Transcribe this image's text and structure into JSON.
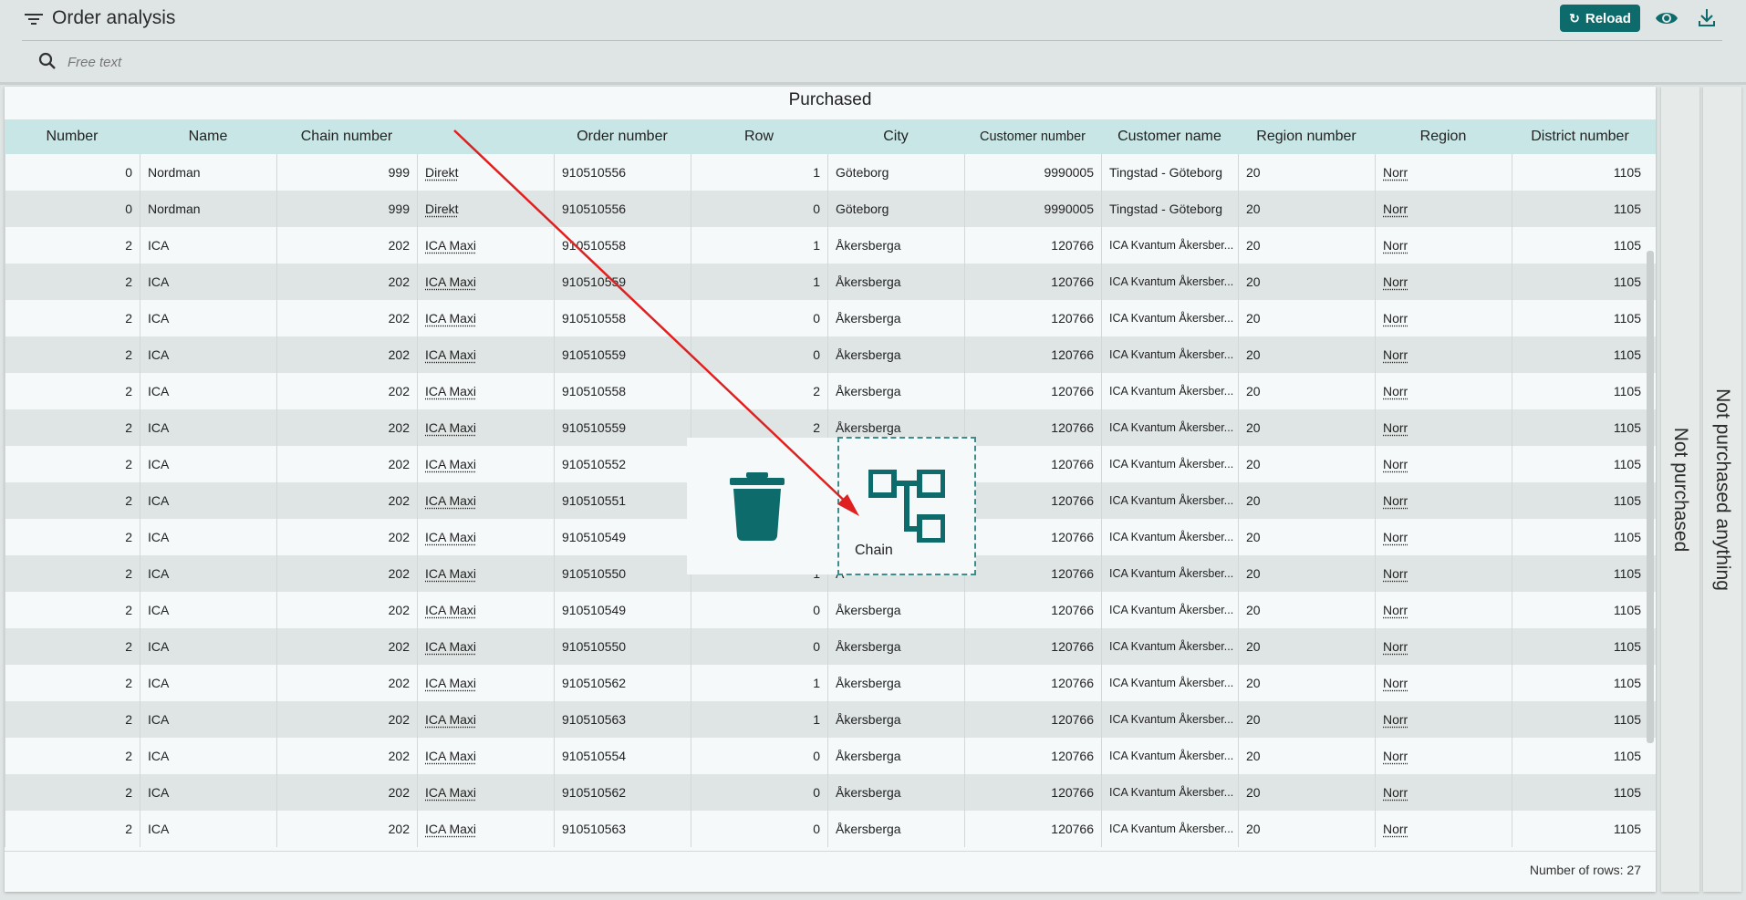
{
  "header": {
    "title": "Order analysis",
    "reload_label": "Reload",
    "search_placeholder": "Free text"
  },
  "panel": {
    "title": "Purchased",
    "row_count_label": "Number of rows: 27"
  },
  "columns": [
    "Number",
    "Name",
    "Chain number",
    "",
    "Order number",
    "Row",
    "City",
    "Customer number",
    "Customer name",
    "Region number",
    "Region",
    "District number"
  ],
  "rows": [
    [
      "0",
      "Nordman",
      "999",
      "Direkt",
      "910510556",
      "1",
      "Göteborg",
      "9990005",
      "Tingstad - Göteborg",
      "20",
      "Norr",
      "1105"
    ],
    [
      "0",
      "Nordman",
      "999",
      "Direkt",
      "910510556",
      "0",
      "Göteborg",
      "9990005",
      "Tingstad - Göteborg",
      "20",
      "Norr",
      "1105"
    ],
    [
      "2",
      "ICA",
      "202",
      "ICA Maxi",
      "910510558",
      "1",
      "Åkersberga",
      "120766",
      "ICA Kvantum Åkersber...",
      "20",
      "Norr",
      "1105"
    ],
    [
      "2",
      "ICA",
      "202",
      "ICA Maxi",
      "910510559",
      "1",
      "Åkersberga",
      "120766",
      "ICA Kvantum Åkersber...",
      "20",
      "Norr",
      "1105"
    ],
    [
      "2",
      "ICA",
      "202",
      "ICA Maxi",
      "910510558",
      "0",
      "Åkersberga",
      "120766",
      "ICA Kvantum Åkersber...",
      "20",
      "Norr",
      "1105"
    ],
    [
      "2",
      "ICA",
      "202",
      "ICA Maxi",
      "910510559",
      "0",
      "Åkersberga",
      "120766",
      "ICA Kvantum Åkersber...",
      "20",
      "Norr",
      "1105"
    ],
    [
      "2",
      "ICA",
      "202",
      "ICA Maxi",
      "910510558",
      "2",
      "Åkersberga",
      "120766",
      "ICA Kvantum Åkersber...",
      "20",
      "Norr",
      "1105"
    ],
    [
      "2",
      "ICA",
      "202",
      "ICA Maxi",
      "910510559",
      "2",
      "Åkersberga",
      "120766",
      "ICA Kvantum Åkersber...",
      "20",
      "Norr",
      "1105"
    ],
    [
      "2",
      "ICA",
      "202",
      "ICA Maxi",
      "910510552",
      "",
      "Å",
      "120766",
      "ICA Kvantum Åkersber...",
      "20",
      "Norr",
      "1105"
    ],
    [
      "2",
      "ICA",
      "202",
      "ICA Maxi",
      "910510551",
      "",
      "Å",
      "120766",
      "ICA Kvantum Åkersber...",
      "20",
      "Norr",
      "1105"
    ],
    [
      "2",
      "ICA",
      "202",
      "ICA Maxi",
      "910510549",
      "",
      "Å",
      "120766",
      "ICA Kvantum Åkersber...",
      "20",
      "Norr",
      "1105"
    ],
    [
      "2",
      "ICA",
      "202",
      "ICA Maxi",
      "910510550",
      "1",
      "Å",
      "120766",
      "ICA Kvantum Åkersber...",
      "20",
      "Norr",
      "1105"
    ],
    [
      "2",
      "ICA",
      "202",
      "ICA Maxi",
      "910510549",
      "0",
      "Åkersberga",
      "120766",
      "ICA Kvantum Åkersber...",
      "20",
      "Norr",
      "1105"
    ],
    [
      "2",
      "ICA",
      "202",
      "ICA Maxi",
      "910510550",
      "0",
      "Åkersberga",
      "120766",
      "ICA Kvantum Åkersber...",
      "20",
      "Norr",
      "1105"
    ],
    [
      "2",
      "ICA",
      "202",
      "ICA Maxi",
      "910510562",
      "1",
      "Åkersberga",
      "120766",
      "ICA Kvantum Åkersber...",
      "20",
      "Norr",
      "1105"
    ],
    [
      "2",
      "ICA",
      "202",
      "ICA Maxi",
      "910510563",
      "1",
      "Åkersberga",
      "120766",
      "ICA Kvantum Åkersber...",
      "20",
      "Norr",
      "1105"
    ],
    [
      "2",
      "ICA",
      "202",
      "ICA Maxi",
      "910510554",
      "0",
      "Åkersberga",
      "120766",
      "ICA Kvantum Åkersber...",
      "20",
      "Norr",
      "1105"
    ],
    [
      "2",
      "ICA",
      "202",
      "ICA Maxi",
      "910510562",
      "0",
      "Åkersberga",
      "120766",
      "ICA Kvantum Åkersber...",
      "20",
      "Norr",
      "1105"
    ],
    [
      "2",
      "ICA",
      "202",
      "ICA Maxi",
      "910510563",
      "0",
      "Åkersberga",
      "120766",
      "ICA Kvantum Åkersber...",
      "20",
      "Norr",
      "1105"
    ]
  ],
  "side_tabs": {
    "not_purchased": "Not purchased",
    "not_purchased_anything": "Not purchased anything"
  },
  "drag": {
    "chip_label": "Chain"
  },
  "colors": {
    "accent": "#0e6b6b",
    "header_row": "#c8e6e6",
    "arrow": "#e02020"
  }
}
